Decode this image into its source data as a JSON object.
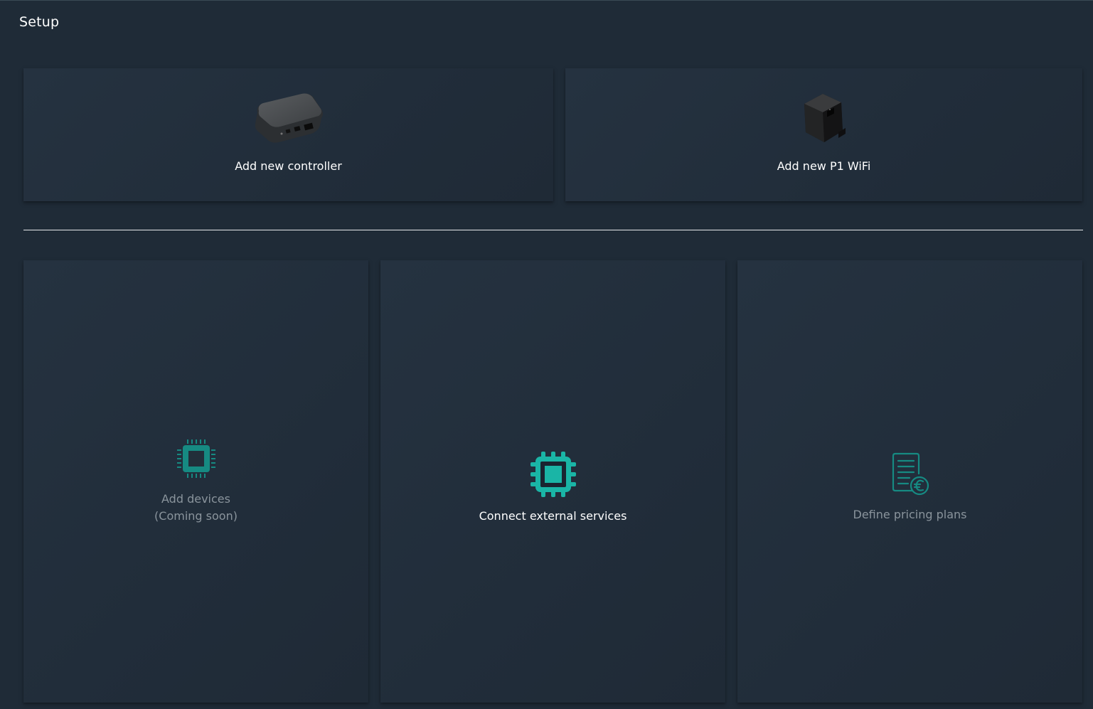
{
  "page": {
    "title": "Setup"
  },
  "top_cards": {
    "controller": {
      "label": "Add new controller",
      "icon": "controller-device-icon"
    },
    "p1wifi": {
      "label": "Add new P1 WiFi",
      "icon": "p1-wifi-device-icon"
    }
  },
  "bottom_cards": {
    "devices": {
      "label": "Add devices",
      "sublabel": "(Coming soon)",
      "icon": "chip-icon"
    },
    "external": {
      "label": "Connect external services",
      "icon": "chip-icon"
    },
    "pricing": {
      "label": "Define pricing plans",
      "icon": "pricing-document-icon"
    }
  },
  "colors": {
    "background": "#1f2b37",
    "accent": "#1ab5a6",
    "accent_dim": "#168a82",
    "muted_text": "#8a949c"
  }
}
